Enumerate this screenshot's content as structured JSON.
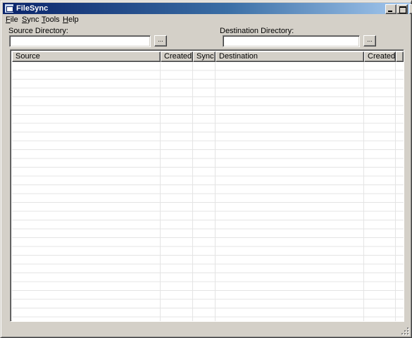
{
  "window": {
    "title": "FileSync",
    "controls": {
      "minimize": "",
      "maximize": "",
      "close": "✕"
    }
  },
  "menu": [
    {
      "label": "File",
      "mnemonic": "F",
      "rest": "ile"
    },
    {
      "label": "Sync",
      "mnemonic": "S",
      "rest": "ync"
    },
    {
      "label": "Tools",
      "mnemonic": "T",
      "rest": "ools"
    },
    {
      "label": "Help",
      "mnemonic": "H",
      "rest": "elp"
    }
  ],
  "source": {
    "label": "Source Directory:",
    "value": "",
    "browse_label": "..."
  },
  "destination": {
    "label": "Destination Directory:",
    "value": "",
    "browse_label": "..."
  },
  "table": {
    "columns": [
      "Source",
      "Created",
      "Sync",
      "Destination",
      "Created"
    ],
    "rows": []
  },
  "colors": {
    "title_gradient_start": "#0a246a",
    "title_gradient_end": "#a6caf0",
    "face": "#d4d0c8",
    "grid_line": "#e4e4e4"
  },
  "icons": [
    "app-icon",
    "minimize-icon",
    "maximize-icon",
    "close-icon",
    "resize-grip-icon"
  ]
}
